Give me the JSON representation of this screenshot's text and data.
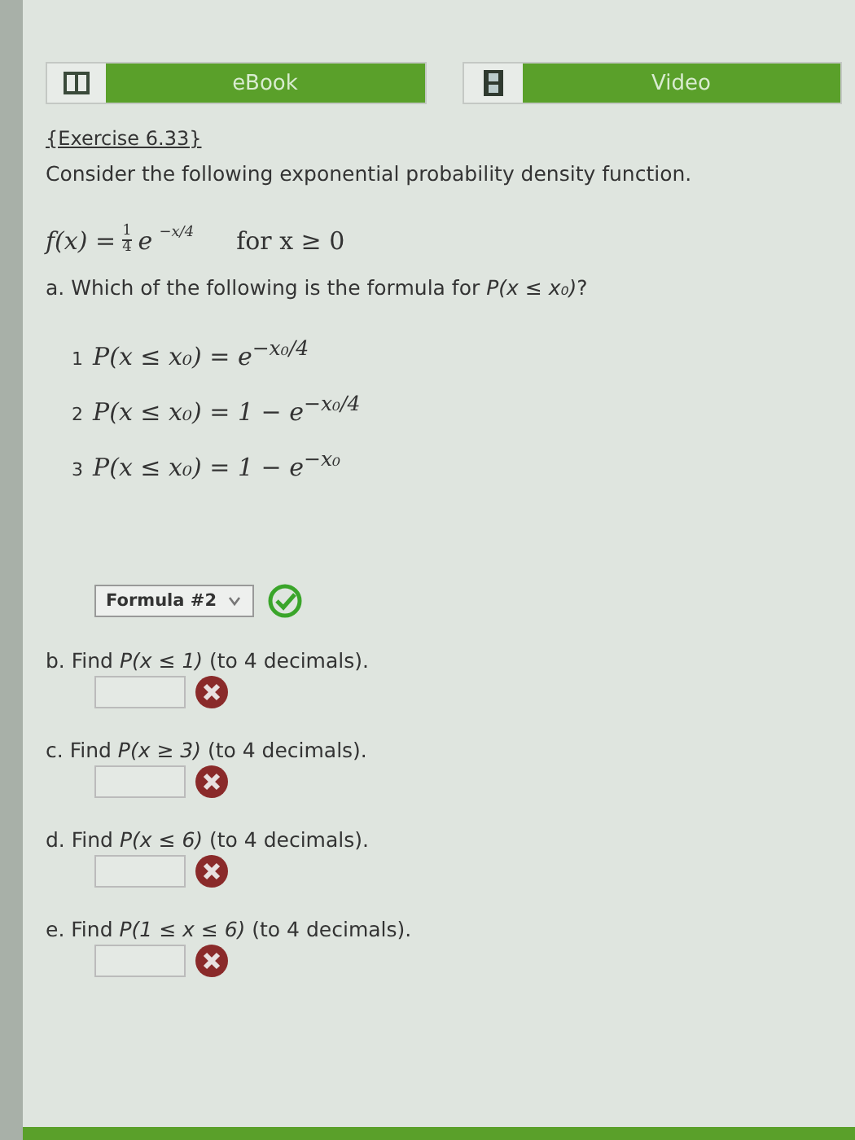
{
  "resources": [
    {
      "kind": "book",
      "label": "eBook"
    },
    {
      "kind": "film",
      "label": "Video"
    }
  ],
  "exercise_link": "{Exercise 6.33}",
  "intro": "Consider the following exponential probability density function.",
  "density": {
    "lhs": "f(x) =",
    "numerator": "1",
    "denominator": "4",
    "base": "e",
    "exponent": "−x/4",
    "condition": "for x ≥ 0"
  },
  "part_a": {
    "prompt": "a. Which of the following is the formula for *P(x ≤ x₀)*?",
    "options": [
      {
        "number": "1",
        "formula": "P(x ≤ x₀) = e$^{−x₀/4}$"
      },
      {
        "number": "2",
        "formula": "P(x ≤ x₀) = 1 − e$^{−x₀/4}$"
      },
      {
        "number": "3",
        "formula": "P(x ≤ x₀) = 1 − e$^{−x₀}$"
      }
    ],
    "answer": "Formula #2",
    "correct": true
  },
  "parts": [
    {
      "prompt": "b. Find *P(x ≤ 1)* (to 4 decimals).",
      "correct": false
    },
    {
      "prompt": "c. Find *P(x ≥ 3)* (to 4 decimals).",
      "correct": false
    },
    {
      "prompt": "d. Find *P(x ≤ 6)* (to 4 decimals).",
      "correct": false
    },
    {
      "prompt": "e. Find *P(1 ≤ x ≤ 6)* (to 4 decimals).",
      "correct": false
    }
  ]
}
